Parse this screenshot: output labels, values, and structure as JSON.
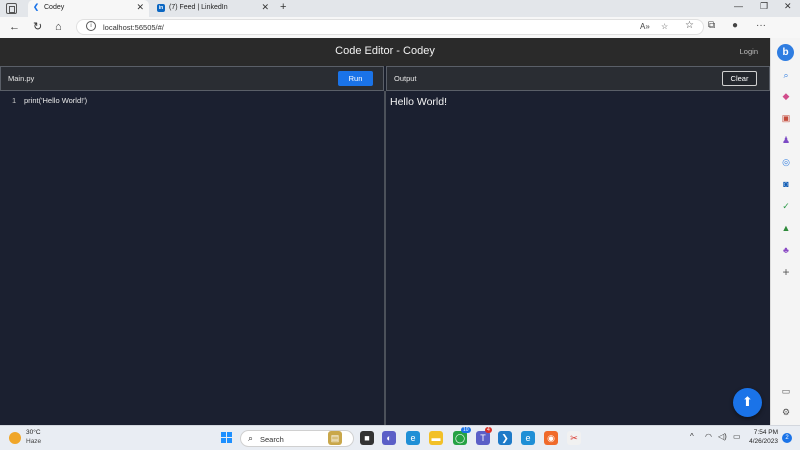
{
  "browser": {
    "tabs": [
      {
        "title": "Codey",
        "active": true
      },
      {
        "title": "(7) Feed | LinkedIn",
        "active": false
      }
    ],
    "address": "localhost:56505/#/",
    "window_controls": [
      "—",
      "❐",
      "✕"
    ]
  },
  "app": {
    "title": "Code Editor - Codey",
    "login_label": "Login"
  },
  "editor": {
    "filename": "Main.py",
    "run_label": "Run",
    "lines": [
      {
        "number": "1",
        "code": "print('Hello World!')"
      }
    ]
  },
  "output": {
    "label": "Output",
    "clear_label": "Clear",
    "text": "Hello World!"
  },
  "taskbar": {
    "weather_temp": "30°C",
    "weather_desc": "Haze",
    "search_label": "Search",
    "time": "7:54 PM",
    "date": "4/26/2023",
    "notification_count": "2",
    "badge_whatsapp": "10",
    "badge_teams": "4"
  },
  "colors": {
    "accent": "#1a73e8",
    "editor_bg": "#1b2030",
    "header_bg": "#2a2a2a"
  }
}
